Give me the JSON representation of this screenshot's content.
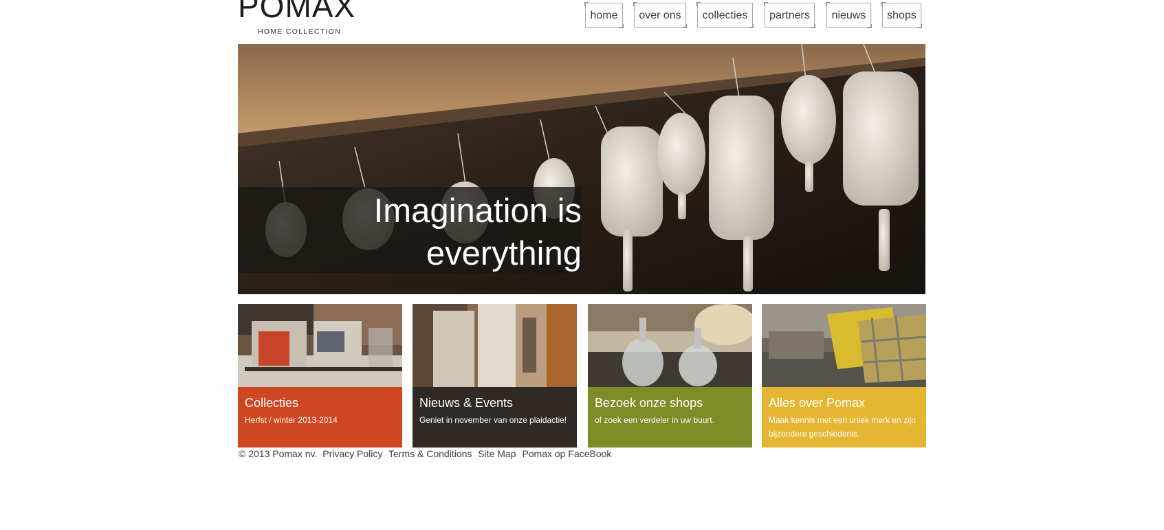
{
  "brand": {
    "name": "POMAX",
    "tagline": "HOME COLLECTION"
  },
  "nav": [
    {
      "label": "home"
    },
    {
      "label": "over ons"
    },
    {
      "label": "collecties"
    },
    {
      "label": "partners"
    },
    {
      "label": "nieuws"
    },
    {
      "label": "shops"
    }
  ],
  "hero": {
    "line1": "Imagination is",
    "line2": "everything"
  },
  "tiles": [
    {
      "title": "Collecties",
      "subtitle": "Herfst / winter 2013-2014",
      "color": "#cf4622"
    },
    {
      "title": "Nieuws & Events",
      "subtitle": "Geniet in november van onze plaidactie!",
      "color": "#2f2a25"
    },
    {
      "title": "Bezoek onze shops",
      "subtitle": "of zoek een verdeler in uw buurt.",
      "color": "#7f8b27"
    },
    {
      "title": "Alles over Pomax",
      "subtitle": "Maak kennis met een uniek merk en zijn bijzondere geschiedenis.",
      "color": "#e4b632"
    }
  ],
  "footer": {
    "copyright": "© 2013 Pomax nv.",
    "links": [
      "Privacy Policy",
      "Terms & Conditions",
      "Site Map",
      "Pomax op FaceBook"
    ]
  }
}
